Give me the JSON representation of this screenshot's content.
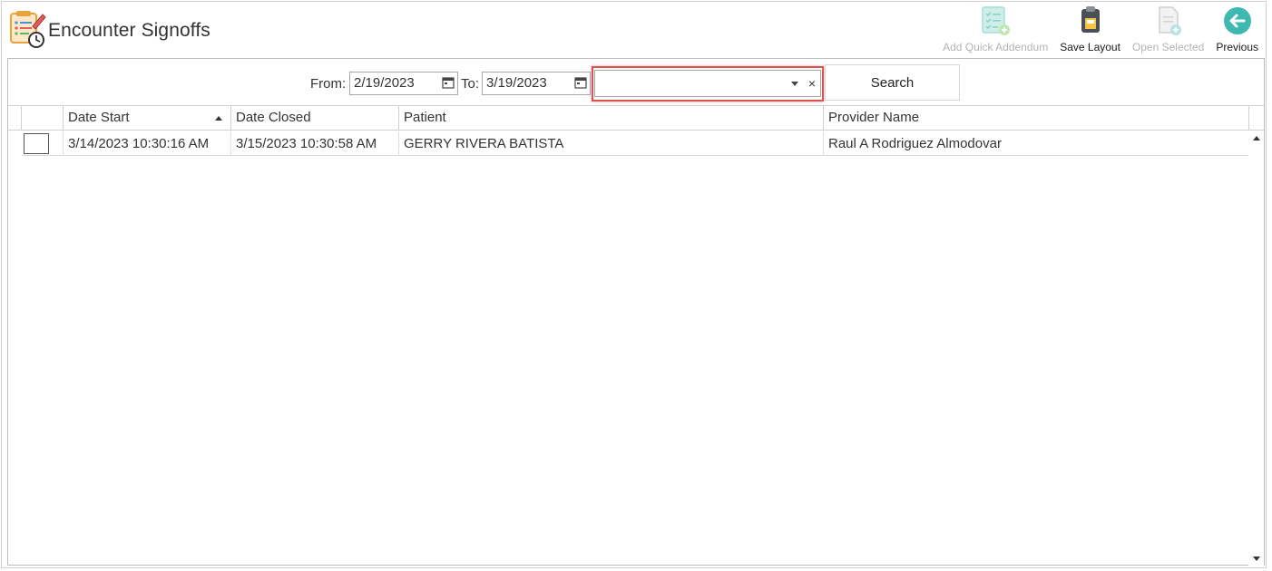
{
  "header": {
    "title": "Encounter Signoffs",
    "app_icon": "checklist-clock-icon"
  },
  "toolbar": {
    "buttons": [
      {
        "label": "Add Quick Addendum",
        "icon": "checklist-add-icon",
        "enabled": false
      },
      {
        "label": "Save Layout",
        "icon": "clipboard-save-icon",
        "enabled": true
      },
      {
        "label": "Open Selected",
        "icon": "document-add-icon",
        "enabled": false
      },
      {
        "label": "Previous",
        "icon": "arrow-left-circle-icon",
        "enabled": true
      }
    ]
  },
  "filters": {
    "from_label": "From:",
    "from_value": "2/19/2023",
    "to_label": "To:",
    "to_value": "3/19/2023",
    "provider_value": "",
    "clear_glyph": "×",
    "search_label": "Search"
  },
  "grid": {
    "columns": [
      "Date Start",
      "Date Closed",
      "Patient",
      "Provider Name"
    ],
    "sorted_column": "Date Start",
    "rows": [
      {
        "date_start": "3/14/2023 10:30:16 AM",
        "date_closed": "3/15/2023 10:30:58 AM",
        "patient": "GERRY RIVERA BATISTA",
        "provider": "Raul A Rodriguez Almodovar",
        "checked": false
      }
    ]
  },
  "colors": {
    "highlight": "#d9534f",
    "accent_teal": "#3fb8b0",
    "disabled_text": "#b4b4b4"
  }
}
